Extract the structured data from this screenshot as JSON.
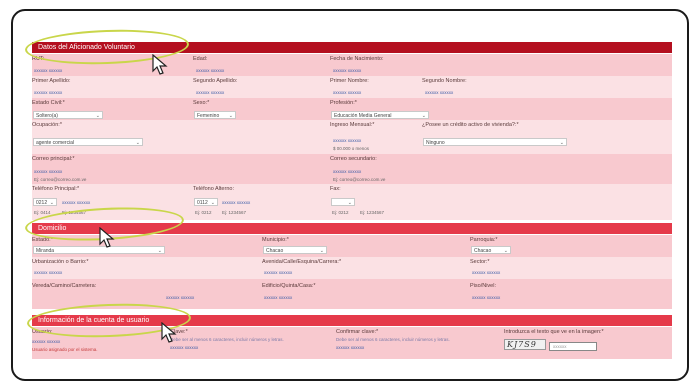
{
  "sections": {
    "volunteer": "Datos del Aficionado Voluntario",
    "address": "Domicilio",
    "account": "Información de la cuenta de usuario"
  },
  "fields": {
    "rut": {
      "label": "RUT:",
      "value": "xxxxxx xxxxxx"
    },
    "edad": {
      "label": "Edad:",
      "value": "xxxxxx xxxxxx"
    },
    "fecha_nac": {
      "label": "Fecha de Nacimiento:",
      "value": "xxxxxx xxxxxx"
    },
    "primer_apellido": {
      "label": "Primer Apellido:",
      "value": "xxxxxx xxxxxx"
    },
    "segundo_apellido": {
      "label": "Segundo Apellido:",
      "value": "xxxxxx xxxxxx"
    },
    "primer_nombre": {
      "label": "Primer Nombre:",
      "value": "xxxxxx xxxxxx"
    },
    "segundo_nombre": {
      "label": "Segundo Nombre:",
      "value": "xxxxxx xxxxxx"
    },
    "estado_civil": {
      "label": "Estado Civil:*",
      "value": "Soltero(a)"
    },
    "sexo": {
      "label": "Sexo:*",
      "value": "Femenino"
    },
    "profesion": {
      "label": "Profesión:*",
      "value": "Educación Media General"
    },
    "ocupacion": {
      "label": "Ocupación:*",
      "value": "agente comercial"
    },
    "ingreso": {
      "label": "Ingreso Mensual:*",
      "value": "xxxxxx xxxxxx",
      "hint": "$ 00.000 o menos"
    },
    "credito": {
      "label": "¿Posee un crédito activo de vivienda?:*",
      "value": "Ninguno"
    },
    "correo_principal": {
      "label": "Correo principal:*",
      "value": "xxxxxx xxxxxx",
      "hint": "Ej: correo@correo.com.ve"
    },
    "correo_secundario": {
      "label": "Correo secundario:",
      "value": "xxxxxx xxxxxx",
      "hint": "Ej: correo@correo.com.ve"
    },
    "telefono_principal": {
      "label": "Teléfono Principal:*",
      "code": "0212",
      "value": "xxxxxx xxxxxx",
      "hint_a": "Ej: 0414",
      "hint_b": "Ej: 1234567"
    },
    "telefono_alterno": {
      "label": "Teléfono Alterno:",
      "code": "0112",
      "value": "xxxxxx xxxxxx",
      "hint_a": "Ej: 0212",
      "hint_b": "Ej: 1234567"
    },
    "fax": {
      "label": "Fax:",
      "code": "",
      "hint_a": "Ej: 0212",
      "hint_b": "Ej: 1234567"
    },
    "estado": {
      "label": "Estado:*",
      "value": "Miranda"
    },
    "municipio": {
      "label": "Municipio:*",
      "value": "Chacao"
    },
    "parroquia": {
      "label": "Parroquia:*",
      "value": "Chacao"
    },
    "urbanizacion": {
      "label": "Urbanización o Barrio:*",
      "value": "xxxxxx xxxxxx"
    },
    "avenida": {
      "label": "Avenida/Calle/Esquina/Carrera:*",
      "value": "xxxxxx xxxxxx"
    },
    "sector": {
      "label": "Sector:*",
      "value": "xxxxxx xxxxxx"
    },
    "vereda": {
      "label": "Vereda/Camino/Carretera:",
      "value": "xxxxxx xxxxxx"
    },
    "edificio": {
      "label": "Edificio/Quinta/Casa:*",
      "value": "xxxxxx xxxxxx"
    },
    "piso": {
      "label": "Piso/Nivel:",
      "value": "xxxxxx xxxxxx"
    },
    "usuario": {
      "label": "Usuario:",
      "value": "xxxxxx xxxxxx",
      "error": "Usuario asignado por el sistema."
    },
    "clave": {
      "label": "Clave:*",
      "value": "xxxxxx xxxxxx",
      "hint": "Debe ser al menos 6 caracteres, incluir números y letras."
    },
    "confirmar_clave": {
      "label": "Confirmar clave:*",
      "value": "xxxxxx xxxxxx",
      "hint": "Debe ser al menos 6 caracteres, incluir números y letras."
    },
    "captcha": {
      "label": "Introduzca el texto que ve en la imagen:*",
      "image_text": "KJ7S9",
      "placeholder": "xxxxxx"
    }
  },
  "colors": {
    "header": "#e53a4a",
    "header_dark": "#b40f1f",
    "row_band": "#f8c9cf",
    "highlight_ring": "#c9d64a"
  },
  "icons": [
    "cursor-arrow-icon",
    "chevron-down-icon"
  ]
}
